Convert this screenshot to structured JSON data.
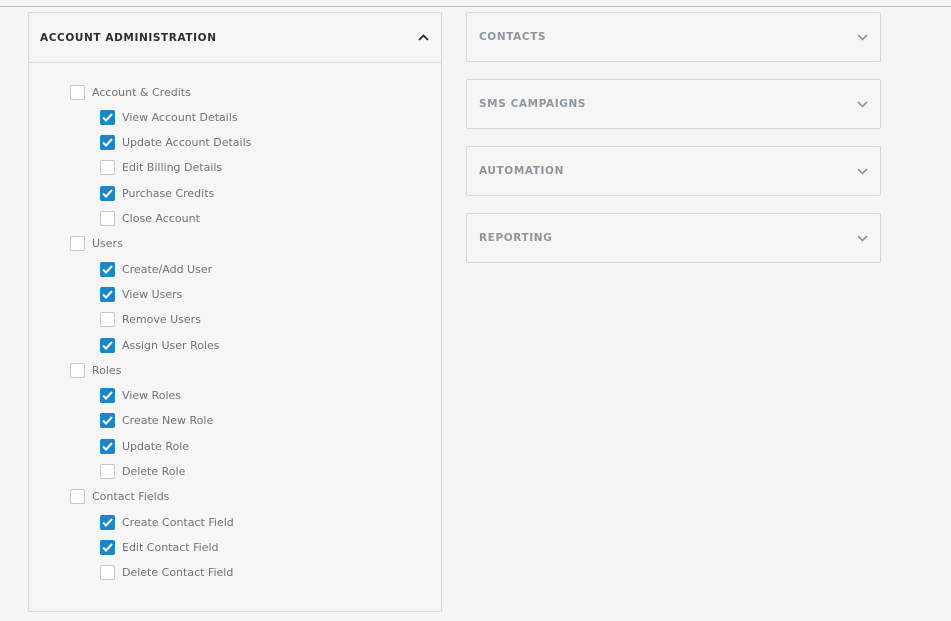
{
  "account_panel": {
    "title": "ACCOUNT ADMINISTRATION",
    "expanded": true,
    "groups": [
      {
        "label": "Account & Credits",
        "checked": false,
        "items": [
          {
            "label": "View Account Details",
            "checked": true
          },
          {
            "label": "Update Account Details",
            "checked": true
          },
          {
            "label": "Edit Billing Details",
            "checked": false
          },
          {
            "label": "Purchase Credits",
            "checked": true
          },
          {
            "label": "Close Account",
            "checked": false
          }
        ]
      },
      {
        "label": "Users",
        "checked": false,
        "items": [
          {
            "label": "Create/Add User",
            "checked": true
          },
          {
            "label": "View Users",
            "checked": true
          },
          {
            "label": "Remove Users",
            "checked": false
          },
          {
            "label": "Assign User Roles",
            "checked": true
          }
        ]
      },
      {
        "label": "Roles",
        "checked": false,
        "items": [
          {
            "label": "View Roles",
            "checked": true
          },
          {
            "label": "Create New Role",
            "checked": true
          },
          {
            "label": "Update Role",
            "checked": true
          },
          {
            "label": "Delete Role",
            "checked": false
          }
        ]
      },
      {
        "label": "Contact Fields",
        "checked": false,
        "items": [
          {
            "label": "Create Contact Field",
            "checked": true
          },
          {
            "label": "Edit Contact Field",
            "checked": true
          },
          {
            "label": "Delete Contact Field",
            "checked": false
          }
        ]
      }
    ]
  },
  "side_panels": [
    {
      "title": "CONTACTS",
      "expanded": false
    },
    {
      "title": "SMS CAMPAIGNS",
      "expanded": false
    },
    {
      "title": "AUTOMATION",
      "expanded": false
    },
    {
      "title": "REPORTING",
      "expanded": false
    }
  ],
  "colors": {
    "accent": "#1d86c6",
    "panel_border": "#d6d6d6",
    "label": "#727272"
  },
  "icons": {
    "collapse": "chevron-up-icon",
    "expand": "chevron-down-icon",
    "check": "checkmark-icon"
  }
}
